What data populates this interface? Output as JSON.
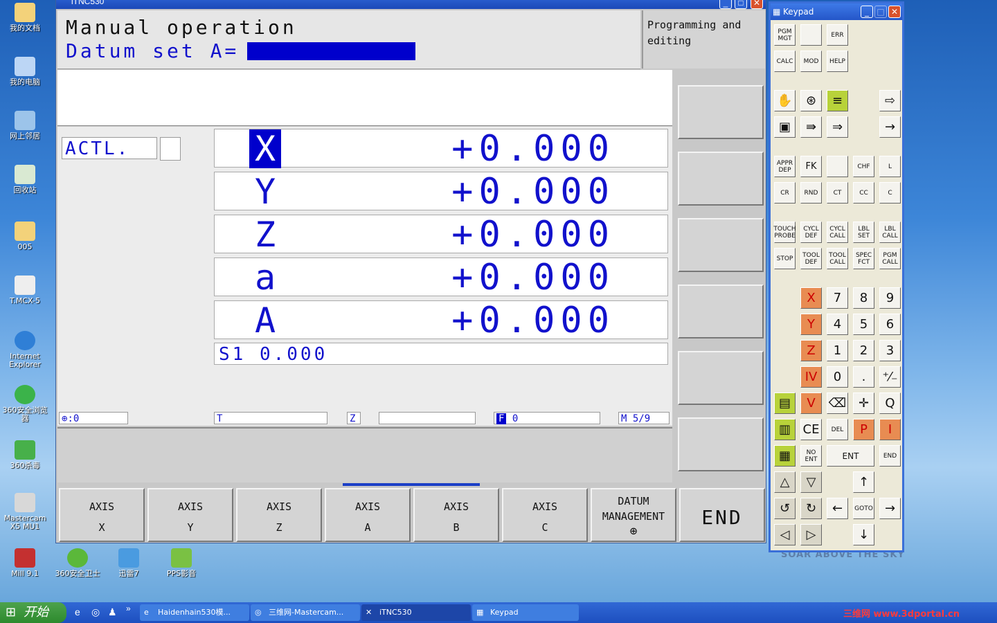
{
  "desktop": {
    "icons": [
      {
        "label": "我的文档"
      },
      {
        "label": "我的电脑"
      },
      {
        "label": "网上邻居"
      },
      {
        "label": "回收站"
      },
      {
        "label": "005"
      },
      {
        "label": "T.MCX-5"
      },
      {
        "label": "Internet Explorer"
      },
      {
        "label": "360安全浏览器"
      },
      {
        "label": "360杀毒"
      },
      {
        "label": "Mastercam X5 MU1"
      },
      {
        "label": "Mill 9.1"
      },
      {
        "label": "360安全卫士"
      },
      {
        "label": "迅雷7"
      },
      {
        "label": "PPS影音"
      }
    ],
    "wallpaper_text": "SOAR ABOVE THE SKY"
  },
  "itnc": {
    "title": "iTNC530",
    "mode_line1": "Manual operation",
    "mode_line2": "Datum set A=",
    "secondary_mode": "Programming and editing",
    "actl_label": "ACTL.",
    "axes": [
      {
        "axis": "X",
        "value": "+0.000"
      },
      {
        "axis": "Y",
        "value": "+0.000"
      },
      {
        "axis": "Z",
        "value": "+0.000"
      },
      {
        "axis": "a",
        "value": "+0.000"
      },
      {
        "axis": "A",
        "value": "+0.000"
      }
    ],
    "spindle_line": "S1   0.000",
    "status": {
      "datum": ":0",
      "tool": "T",
      "tool_axis": "Z",
      "feed_label": "F",
      "feed": "0",
      "misc": "M 5/9"
    },
    "softkeys": [
      {
        "line1": "AXIS",
        "line2": "X"
      },
      {
        "line1": "AXIS",
        "line2": "Y"
      },
      {
        "line1": "AXIS",
        "line2": "Z"
      },
      {
        "line1": "AXIS",
        "line2": "A"
      },
      {
        "line1": "AXIS",
        "line2": "B"
      },
      {
        "line1": "AXIS",
        "line2": "C"
      },
      {
        "line1": "DATUM",
        "line2": "MANAGEMENT"
      },
      {
        "line1": "END",
        "line2": ""
      }
    ]
  },
  "keypad": {
    "title": "Keypad",
    "keys": {
      "pgm_mgt": "PGM MGT",
      "err": "ERR",
      "calc": "CALC",
      "mod": "MOD",
      "help": "HELP",
      "appr": "APPR DEP",
      "fk": "FK",
      "chf": "CHF",
      "l": "L",
      "cr": "CR",
      "rnd": "RND",
      "ct": "CT",
      "cc": "CC",
      "c": "C",
      "touch": "TOUCH PROBE",
      "cycl_def": "CYCL DEF",
      "cycl_call": "CYCL CALL",
      "lbl_set": "LBL SET",
      "lbl_call": "LBL CALL",
      "stop": "STOP",
      "tool_def": "TOOL DEF",
      "tool_call": "TOOL CALL",
      "spec": "SPEC FCT",
      "pgm_call": "PGM CALL",
      "x": "X",
      "y": "Y",
      "z": "Z",
      "iv": "IV",
      "v": "V",
      "n7": "7",
      "n8": "8",
      "n9": "9",
      "n4": "4",
      "n5": "5",
      "n6": "6",
      "n1": "1",
      "n2": "2",
      "n3": "3",
      "n0": "0",
      "dot": ".",
      "pm": "⁺⁄₋",
      "q": "Q",
      "ce": "CE",
      "del": "DEL",
      "p": "P",
      "i": "I",
      "no_ent": "NO ENT",
      "ent": "ENT",
      "end": "END",
      "goto": "GOTO"
    }
  },
  "taskbar": {
    "start": "开始",
    "tasks": [
      {
        "label": "Haidenhain530模..."
      },
      {
        "label": "三维网-Mastercam..."
      },
      {
        "label": "iTNC530"
      },
      {
        "label": "Keypad"
      }
    ],
    "tray_text": "三维网 www.3dportal.cn"
  }
}
